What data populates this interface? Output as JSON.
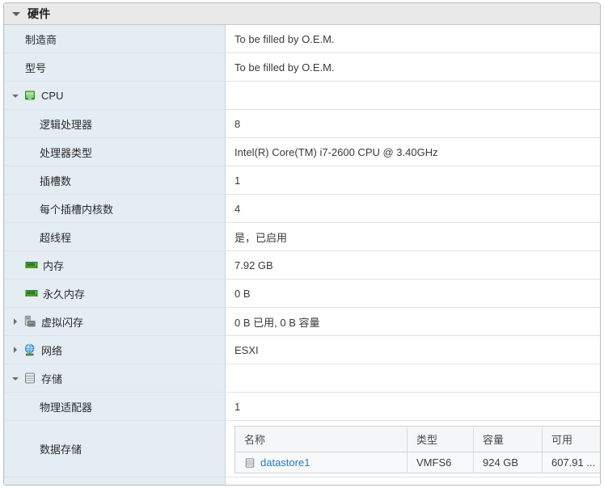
{
  "panel": {
    "title": "硬件",
    "expanded": true
  },
  "rows": [
    {
      "key": "制造商",
      "value": "To be filled by O.E.M.",
      "indent": 1,
      "icon": null,
      "caret": "none"
    },
    {
      "key": "型号",
      "value": "To be filled by O.E.M.",
      "indent": 1,
      "icon": null,
      "caret": "none"
    },
    {
      "key": "CPU",
      "value": "",
      "indent": 0,
      "icon": "cpu-icon",
      "caret": "open"
    },
    {
      "key": "逻辑处理器",
      "value": "8",
      "indent": 2,
      "icon": null,
      "caret": "none"
    },
    {
      "key": "处理器类型",
      "value": "Intel(R) Core(TM) i7-2600 CPU @ 3.40GHz",
      "indent": 2,
      "icon": null,
      "caret": "none"
    },
    {
      "key": "插槽数",
      "value": "1",
      "indent": 2,
      "icon": null,
      "caret": "none"
    },
    {
      "key": "每个插槽内核数",
      "value": "4",
      "indent": 2,
      "icon": null,
      "caret": "none"
    },
    {
      "key": "超线程",
      "value": "是，已启用",
      "indent": 2,
      "icon": null,
      "caret": "none"
    },
    {
      "key": "内存",
      "value": "7.92 GB",
      "indent": 1,
      "icon": "memory-icon",
      "caret": "none"
    },
    {
      "key": "永久内存",
      "value": "0 B",
      "indent": 1,
      "icon": "memory-icon",
      "caret": "none"
    },
    {
      "key": "虚拟闪存",
      "value": "0 B 已用, 0 B 容量",
      "indent": 0,
      "icon": "flash-device-icon",
      "caret": "closed"
    },
    {
      "key": "网络",
      "value": "ESXI",
      "indent": 0,
      "icon": "network-globe-icon",
      "caret": "closed"
    },
    {
      "key": "存储",
      "value": "",
      "indent": 0,
      "icon": "storage-icon",
      "caret": "open"
    },
    {
      "key": "物理适配器",
      "value": "1",
      "indent": 2,
      "icon": null,
      "caret": "none"
    },
    {
      "key": "数据存储",
      "value": "",
      "indent": 2,
      "icon": null,
      "caret": "none"
    }
  ],
  "datastore_table": {
    "columns": [
      "名称",
      "类型",
      "容量",
      "可用"
    ],
    "rows": [
      {
        "name": "datastore1",
        "type": "VMFS6",
        "capacity": "924 GB",
        "free": "607.91 ..."
      }
    ]
  },
  "colors": {
    "key_column_bg": "#e4edf4",
    "header_bg": "#e9e9e9",
    "link": "#2b7ab5",
    "icon_green": "#3f9c35",
    "icon_gray": "#8a8f94",
    "icon_blue": "#3f8fd0"
  }
}
